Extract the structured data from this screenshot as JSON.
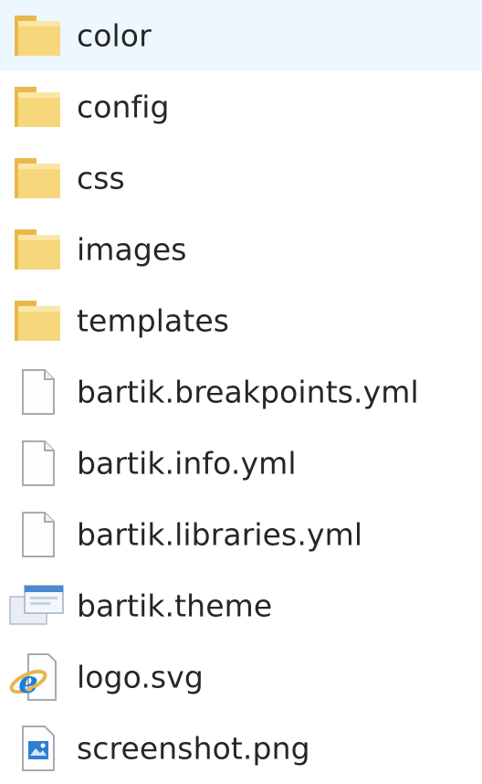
{
  "colors": {
    "folder": "#f2c95e",
    "folder_light": "#f8dd8a",
    "text": "#262626",
    "doc_border": "#9aa0a6",
    "ie_blue": "#1b7fd6",
    "ie_ring": "#e8b64a"
  },
  "files": [
    {
      "name": "color",
      "type": "folder",
      "icon": "folder-icon"
    },
    {
      "name": "config",
      "type": "folder",
      "icon": "folder-icon"
    },
    {
      "name": "css",
      "type": "folder",
      "icon": "folder-icon"
    },
    {
      "name": "images",
      "type": "folder",
      "icon": "folder-icon"
    },
    {
      "name": "templates",
      "type": "folder",
      "icon": "folder-icon"
    },
    {
      "name": "bartik.breakpoints.yml",
      "type": "file",
      "icon": "document-icon"
    },
    {
      "name": "bartik.info.yml",
      "type": "file",
      "icon": "document-icon"
    },
    {
      "name": "bartik.libraries.yml",
      "type": "file",
      "icon": "document-icon"
    },
    {
      "name": "bartik.theme",
      "type": "file",
      "icon": "theme-file-icon"
    },
    {
      "name": "logo.svg",
      "type": "file",
      "icon": "internet-explorer-icon"
    },
    {
      "name": "screenshot.png",
      "type": "file",
      "icon": "image-file-icon"
    }
  ]
}
